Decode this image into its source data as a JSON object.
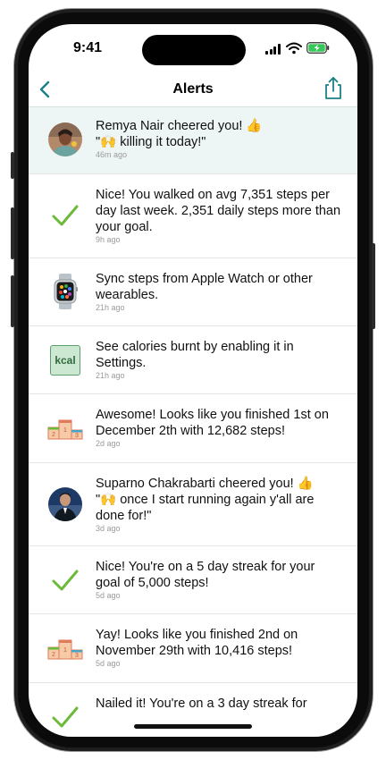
{
  "status_bar": {
    "time": "9:41"
  },
  "nav": {
    "title": "Alerts",
    "back_icon": "chevron-left-icon",
    "share_icon": "share-icon",
    "accent_color": "#1b7f86"
  },
  "alerts": [
    {
      "icon": "avatar-remya",
      "message": "Remya Nair cheered you! 👍",
      "message2": "\"🙌 killing it today!\"",
      "time": "46m ago"
    },
    {
      "icon": "checkmark-icon",
      "message": "Nice! You walked on avg 7,351 steps per day last week. 2,351 daily steps more than your goal.",
      "time": "9h ago"
    },
    {
      "icon": "apple-watch-icon",
      "message": "Sync steps from Apple Watch or other wearables.",
      "time": "21h ago"
    },
    {
      "icon": "kcal-icon",
      "icon_label": "kcal",
      "message": "See calories burnt by enabling it in Settings.",
      "time": "21h ago"
    },
    {
      "icon": "podium-icon",
      "message": "Awesome! Looks like you finished 1st on December 2th with 12,682 steps!",
      "time": "2d ago"
    },
    {
      "icon": "avatar-suparno",
      "message": "Suparno Chakrabarti cheered you! 👍",
      "message2": "\"🙌 once I start running again y'all are done for!\"",
      "time": "3d ago"
    },
    {
      "icon": "checkmark-icon",
      "message": "Nice! You're on a 5 day streak for your goal of 5,000 steps!",
      "time": "5d ago"
    },
    {
      "icon": "podium-icon",
      "message": "Yay! Looks like you finished 2nd on November 29th with 10,416 steps!",
      "time": "5d ago"
    },
    {
      "icon": "checkmark-icon",
      "message": "Nailed it! You're on a 3 day streak for",
      "time": ""
    }
  ]
}
